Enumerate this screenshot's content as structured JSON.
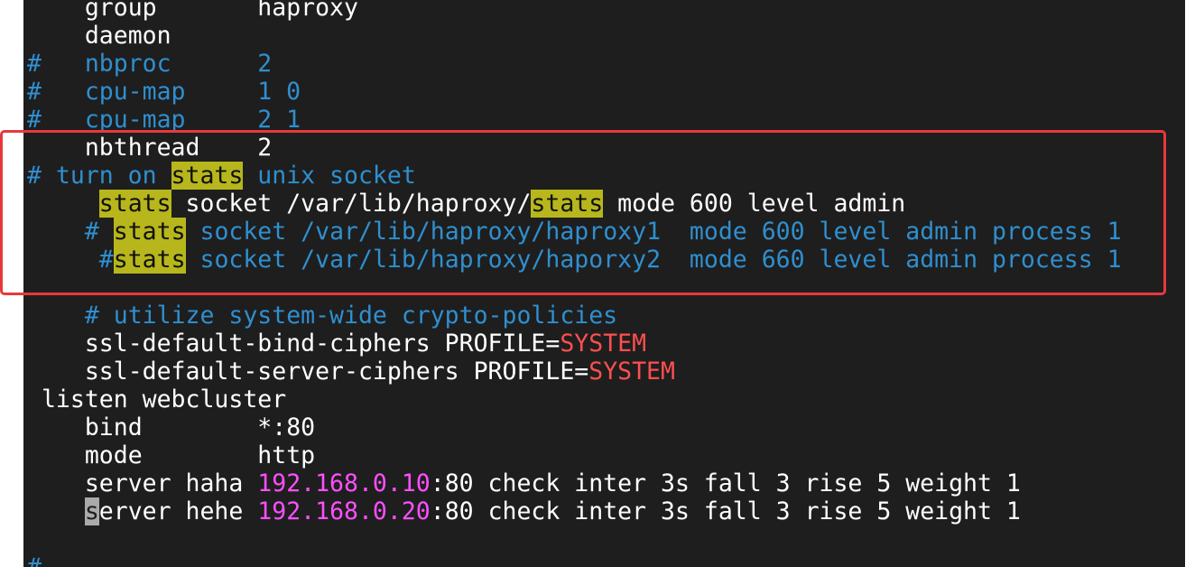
{
  "lines": [
    {
      "indent": "    ",
      "parts": [
        {
          "t": "group       haproxy",
          "c": ""
        }
      ]
    },
    {
      "indent": "    ",
      "parts": [
        {
          "t": "daemon",
          "c": ""
        }
      ]
    },
    {
      "indent": "",
      "parts": [
        {
          "t": "#   nbproc      2",
          "c": "c"
        }
      ]
    },
    {
      "indent": "",
      "parts": [
        {
          "t": "#   cpu-map     1 0",
          "c": "c"
        }
      ]
    },
    {
      "indent": "",
      "parts": [
        {
          "t": "#   cpu-map     2 1",
          "c": "c"
        }
      ]
    },
    {
      "indent": "    ",
      "parts": [
        {
          "t": "nbthread    2",
          "c": ""
        }
      ]
    },
    {
      "indent": "",
      "parts": [
        {
          "t": "# turn on ",
          "c": "c"
        },
        {
          "t": "stats",
          "c": "hl"
        },
        {
          "t": " unix socket",
          "c": "c"
        }
      ]
    },
    {
      "indent": "     ",
      "parts": [
        {
          "t": "stats",
          "c": "hl"
        },
        {
          "t": " socket /var/lib/haproxy/",
          "c": ""
        },
        {
          "t": "stats",
          "c": "hl"
        },
        {
          "t": " mode 600 level admin",
          "c": ""
        }
      ]
    },
    {
      "indent": "    ",
      "parts": [
        {
          "t": "# ",
          "c": "c"
        },
        {
          "t": "stats",
          "c": "hl"
        },
        {
          "t": " socket /var/lib/haproxy/haproxy1  mode 600 level admin process 1",
          "c": "c"
        }
      ]
    },
    {
      "indent": "     ",
      "parts": [
        {
          "t": "#",
          "c": "c"
        },
        {
          "t": "stats",
          "c": "hl"
        },
        {
          "t": " socket /var/lib/haproxy/haporxy2  mode 660 level admin process 1",
          "c": "c"
        }
      ]
    },
    {
      "indent": "",
      "parts": [
        {
          "t": "",
          "c": ""
        }
      ]
    },
    {
      "indent": "    ",
      "parts": [
        {
          "t": "# utilize system-wide crypto-policies",
          "c": "c"
        }
      ]
    },
    {
      "indent": "    ",
      "parts": [
        {
          "t": "ssl-default-bind-ciphers PROFILE=",
          "c": ""
        },
        {
          "t": "SYSTEM",
          "c": "red"
        }
      ]
    },
    {
      "indent": "    ",
      "parts": [
        {
          "t": "ssl-default-server-ciphers PROFILE=",
          "c": ""
        },
        {
          "t": "SYSTEM",
          "c": "red"
        }
      ]
    },
    {
      "indent": " ",
      "parts": [
        {
          "t": "listen webcluster",
          "c": ""
        }
      ]
    },
    {
      "indent": "    ",
      "parts": [
        {
          "t": "bind        *:80",
          "c": ""
        }
      ]
    },
    {
      "indent": "    ",
      "parts": [
        {
          "t": "mode        http",
          "c": ""
        }
      ]
    },
    {
      "indent": "    ",
      "parts": [
        {
          "t": "server haha ",
          "c": ""
        },
        {
          "t": "192.168.0.10",
          "c": "mag"
        },
        {
          "t": ":80 check inter 3s fall 3 rise 5 weight 1",
          "c": ""
        }
      ]
    },
    {
      "indent": "    ",
      "parts": [
        {
          "t": "s",
          "c": "cursor"
        },
        {
          "t": "erver hehe ",
          "c": ""
        },
        {
          "t": "192.168.0.20",
          "c": "mag"
        },
        {
          "t": ":80 check inter 3s fall 3 rise 5 weight 1",
          "c": ""
        }
      ]
    },
    {
      "indent": "",
      "parts": [
        {
          "t": "",
          "c": ""
        }
      ]
    },
    {
      "indent": "",
      "parts": [
        {
          "t": "#",
          "c": "c"
        }
      ]
    }
  ]
}
